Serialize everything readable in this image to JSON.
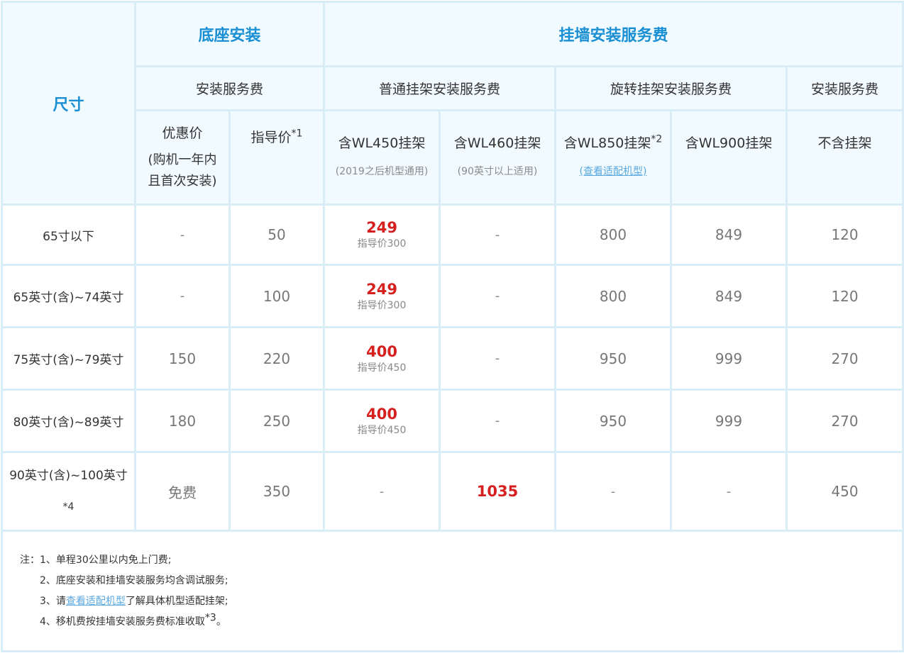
{
  "headers": {
    "size": "尺寸",
    "base_install": "底座安装",
    "wall_install": "挂墙安装服务费",
    "install_fee": "安装服务费",
    "normal_mount": "普通挂架安装服务费",
    "rotating_mount": "旋转挂架安装服务费",
    "install_fee_2": "安装服务费",
    "discount_price": "优惠价",
    "discount_note_1": "(购机一年内",
    "discount_note_2": "且首次安装)",
    "guide_price": "指导价",
    "guide_sup": "*1",
    "wl450": "含WL450挂架",
    "wl450_note": "(2019之后机型通用)",
    "wl460": "含WL460挂架",
    "wl460_note": "(90英寸以上适用)",
    "wl850": "含WL850挂架",
    "wl850_sup": "*2",
    "wl850_link": "(查看适配机型)",
    "wl900": "含WL900挂架",
    "no_mount": "不含挂架"
  },
  "rows": [
    {
      "size": "65寸以下",
      "size_sup": "",
      "discount": "-",
      "guide": "50",
      "wl450": "249",
      "wl450_guide": "指导价300",
      "wl460": "-",
      "wl850": "800",
      "wl900": "849",
      "no_mount": "120"
    },
    {
      "size": "65英寸(含)~74英寸",
      "size_sup": "",
      "discount": "-",
      "guide": "100",
      "wl450": "249",
      "wl450_guide": "指导价300",
      "wl460": "-",
      "wl850": "800",
      "wl900": "849",
      "no_mount": "120"
    },
    {
      "size": "75英寸(含)~79英寸",
      "size_sup": "",
      "discount": "150",
      "guide": "220",
      "wl450": "400",
      "wl450_guide": "指导价450",
      "wl460": "-",
      "wl850": "950",
      "wl900": "999",
      "no_mount": "270"
    },
    {
      "size": "80英寸(含)~89英寸",
      "size_sup": "",
      "discount": "180",
      "guide": "250",
      "wl450": "400",
      "wl450_guide": "指导价450",
      "wl460": "-",
      "wl850": "950",
      "wl900": "999",
      "no_mount": "270"
    },
    {
      "size": "90英寸(含)~100英寸",
      "size_sup": "*4",
      "discount": "免费",
      "guide": "350",
      "wl450": "-",
      "wl450_guide": "",
      "wl460": "1035",
      "wl850": "-",
      "wl900": "-",
      "no_mount": "450"
    }
  ],
  "notes": {
    "line1": "注：1、单程30公里以内免上门费;",
    "line2": "2、底座安装和挂墙安装服务均含调试服务;",
    "line3_prefix": "3、请",
    "line3_link": "查看适配机型",
    "line3_suffix": "了解具体机型适配挂架;",
    "line4": "4、移机费按挂墙安装服务费标准收取",
    "line4_sup": "*3",
    "line4_end": "。"
  },
  "colors": {
    "title_blue": "#1a8fd4",
    "price_red": "#d62020",
    "border": "#d8edf6",
    "header_bg": "#f1fbff",
    "link_blue": "#5aa8e0"
  }
}
